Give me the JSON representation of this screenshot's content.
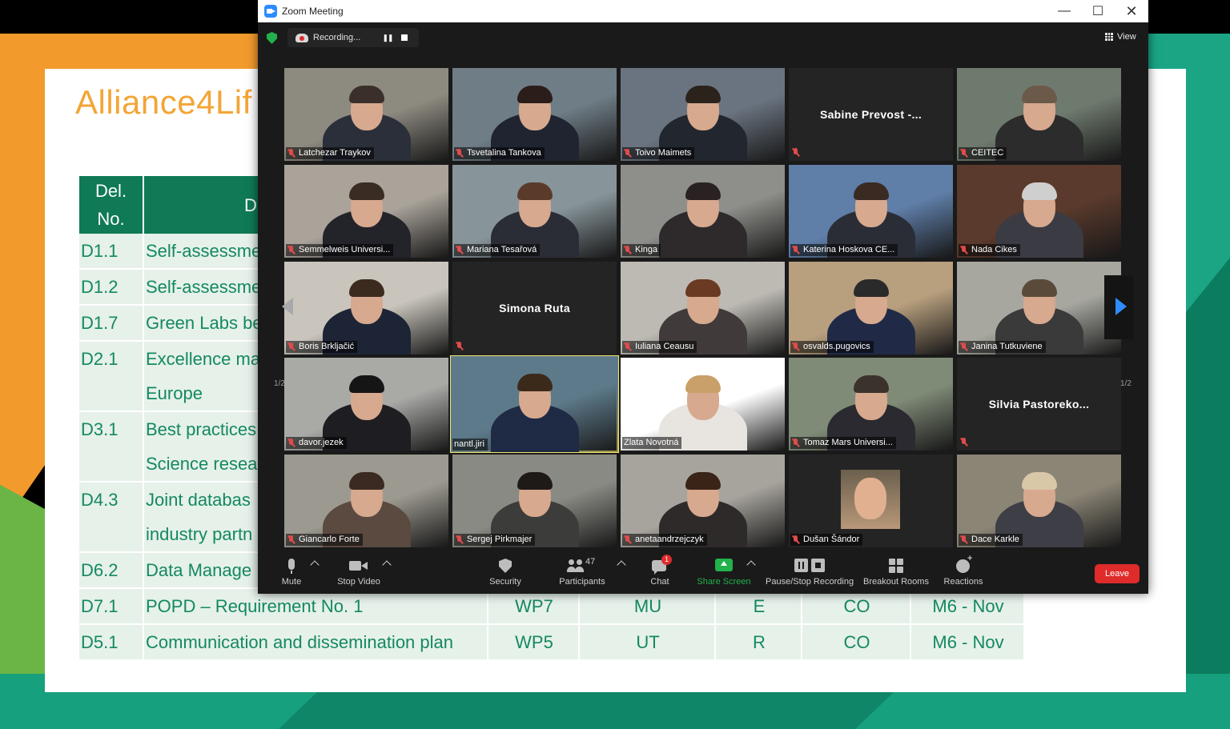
{
  "slide": {
    "logo_text": "Alliance4Lif",
    "table": {
      "headers": [
        "Del.\nNo.",
        "D"
      ],
      "rows": [
        {
          "id": "D1.1",
          "title": "Self-assessme",
          "wp": "",
          "lead": "",
          "type": "",
          "diss": "",
          "month": ""
        },
        {
          "id": "D1.2",
          "title": "Self-assessme",
          "wp": "",
          "lead": "",
          "type": "",
          "diss": "",
          "month": ""
        },
        {
          "id": "D1.7",
          "title": "Green Labs be",
          "wp": "",
          "lead": "",
          "type": "",
          "diss": "",
          "month": ""
        },
        {
          "id": "D2.1",
          "title": "Excellence ma",
          "title2": "Europe",
          "wp": "",
          "lead": "",
          "type": "",
          "diss": "",
          "month": ""
        },
        {
          "id": "D3.1",
          "title": "Best practices",
          "title2": "Science resea",
          "wp": "",
          "lead": "",
          "type": "",
          "diss": "",
          "month": ""
        },
        {
          "id": "D4.3",
          "title": "Joint databas",
          "title2": "industry partn",
          "wp": "",
          "lead": "",
          "type": "",
          "diss": "",
          "month": ""
        },
        {
          "id": "D6.2",
          "title": "Data Manage",
          "wp": "",
          "lead": "",
          "type": "",
          "diss": "",
          "month": ""
        },
        {
          "id": "D7.1",
          "title": "POPD – Requirement No. 1",
          "wp": "WP7",
          "lead": "MU",
          "type": "E",
          "diss": "CO",
          "month": "M6 - Nov"
        },
        {
          "id": "D5.1",
          "title": "Communication and dissemination plan",
          "wp": "WP5",
          "lead": "UT",
          "type": "R",
          "diss": "CO",
          "month": "M6 - Nov"
        }
      ]
    }
  },
  "window": {
    "title": "Zoom Meeting",
    "minimize": "—",
    "maximize": "☐",
    "close": "✕"
  },
  "topbar": {
    "recording_label": "Recording...",
    "pause_glyph": "❚❚",
    "view_label": "View"
  },
  "gallery": {
    "page_left": "1/2",
    "page_right": "1/2",
    "participants": [
      {
        "name": "Latchezar Traykov",
        "video": true,
        "muted": true
      },
      {
        "name": "Tsvetalina Tankova",
        "video": true,
        "muted": true
      },
      {
        "name": "Toivo Maimets",
        "video": true,
        "muted": true
      },
      {
        "name": "Sabine  Prevost  -...",
        "video": false,
        "muted": true
      },
      {
        "name": "CEITEC",
        "video": true,
        "muted": true
      },
      {
        "name": "Semmelweis Universi...",
        "video": true,
        "muted": true
      },
      {
        "name": "Mariana Tesařová",
        "video": true,
        "muted": true
      },
      {
        "name": "Kinga",
        "video": true,
        "muted": true
      },
      {
        "name": "Katerina Hoskova CE...",
        "video": true,
        "muted": true
      },
      {
        "name": "Nada Cikes",
        "video": true,
        "muted": true
      },
      {
        "name": "Boris Brkljačić",
        "video": true,
        "muted": true
      },
      {
        "name": "Simona Ruta",
        "video": false,
        "muted": true
      },
      {
        "name": "Iuliana Ceausu",
        "video": true,
        "muted": true
      },
      {
        "name": "osvalds.pugovics",
        "video": true,
        "muted": true
      },
      {
        "name": "Janina Tutkuviene",
        "video": true,
        "muted": true
      },
      {
        "name": "davor.jezek",
        "video": true,
        "muted": true
      },
      {
        "name": "nantl.jiri",
        "video": true,
        "muted": false,
        "speaking": true
      },
      {
        "name": "Zlata Novotná",
        "video": true,
        "muted": false
      },
      {
        "name": "Tomaz Mars Universi...",
        "video": true,
        "muted": true
      },
      {
        "name": "Silvia  Pastoreko...",
        "video": false,
        "muted": true
      },
      {
        "name": "Giancarlo Forte",
        "video": true,
        "muted": true
      },
      {
        "name": "Sergej Pirkmajer",
        "video": true,
        "muted": true
      },
      {
        "name": "anetaandrzejczyk",
        "video": true,
        "muted": true
      },
      {
        "name": "Dušan Šándor",
        "video": false,
        "muted": true,
        "avatar": true
      },
      {
        "name": "Dace Karkle",
        "video": true,
        "muted": true
      }
    ]
  },
  "toolbar": {
    "mute": "Mute",
    "stop_video": "Stop Video",
    "security": "Security",
    "participants": "Participants",
    "participant_count": "47",
    "chat": "Chat",
    "chat_badge": "1",
    "share_screen": "Share Screen",
    "record": "Pause/Stop Recording",
    "breakout": "Breakout Rooms",
    "reactions": "Reactions",
    "leave": "Leave"
  },
  "colors": {
    "zoom_blue": "#2d8cff",
    "share_green": "#22b14c",
    "leave_red": "#e02b2b",
    "slide_green": "#0f7a55",
    "slide_orange": "#f39a2d",
    "speaking_outline": "#f3e870"
  }
}
